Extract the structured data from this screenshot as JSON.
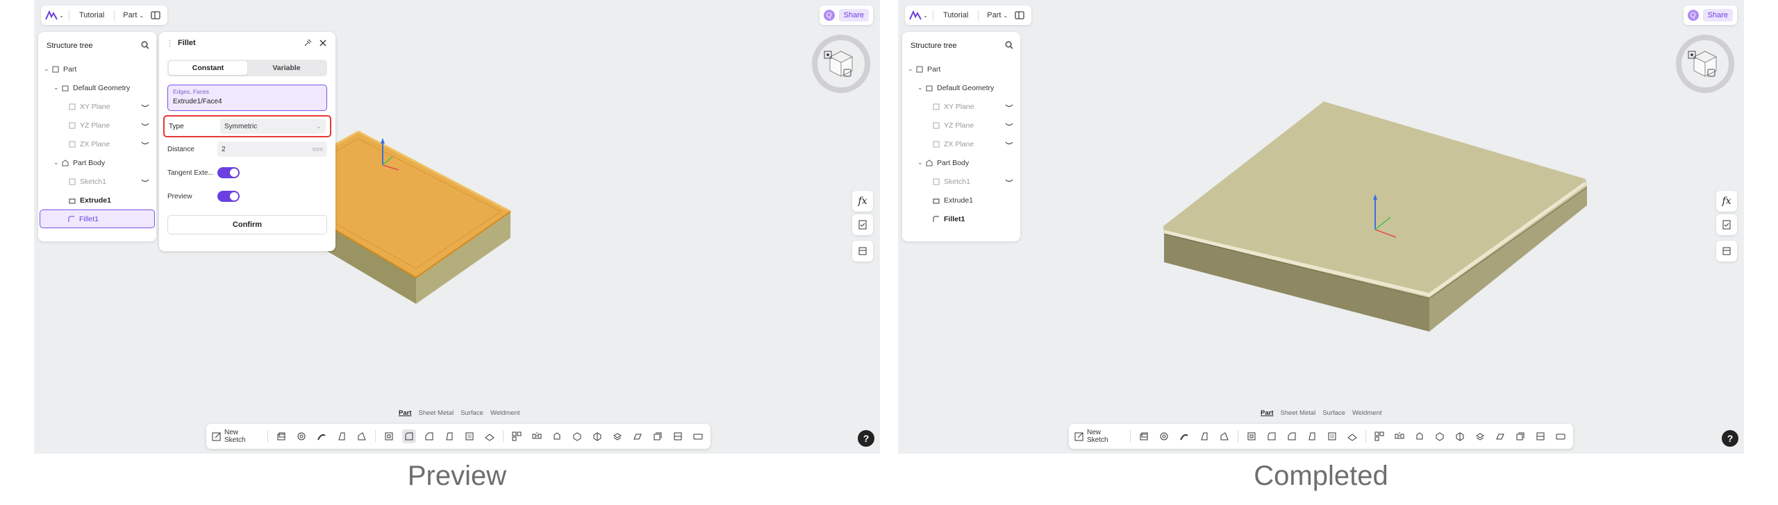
{
  "captions": {
    "left": "Preview",
    "right": "Completed"
  },
  "topbar": {
    "project": "Tutorial",
    "mode": "Part",
    "share": "Share",
    "avatar_letter": "Q"
  },
  "tree": {
    "title": "Structure tree",
    "items": [
      {
        "label": "Part"
      },
      {
        "label": "Default Geometry"
      },
      {
        "label": "XY Plane"
      },
      {
        "label": "YZ Plane"
      },
      {
        "label": "ZX Plane"
      },
      {
        "label": "Part Body"
      },
      {
        "label": "Sketch1"
      },
      {
        "label": "Extrude1"
      },
      {
        "label": "Fillet1"
      }
    ]
  },
  "dialog": {
    "title": "Fillet",
    "tabs": [
      "Constant",
      "Variable"
    ],
    "selection_label": "Edges, Faces",
    "selection_value": "Extrude1/Face4",
    "type_label": "Type",
    "type_value": "Symmetric",
    "distance_label": "Distance",
    "distance_value": "2",
    "distance_unit": "mm",
    "tangent_label": "Tangent Exte...",
    "preview_label": "Preview",
    "confirm": "Confirm"
  },
  "bottom_tabs": [
    "Part",
    "Sheet Metal",
    "Surface",
    "Weldment"
  ],
  "toolbar": {
    "new_sketch": "New Sketch"
  },
  "colors": {
    "accent": "#6b3fe0",
    "highlight": "#e8a43a",
    "plate": "#cfc99a",
    "background": "#eceef0",
    "error_outline": "#e53935"
  }
}
